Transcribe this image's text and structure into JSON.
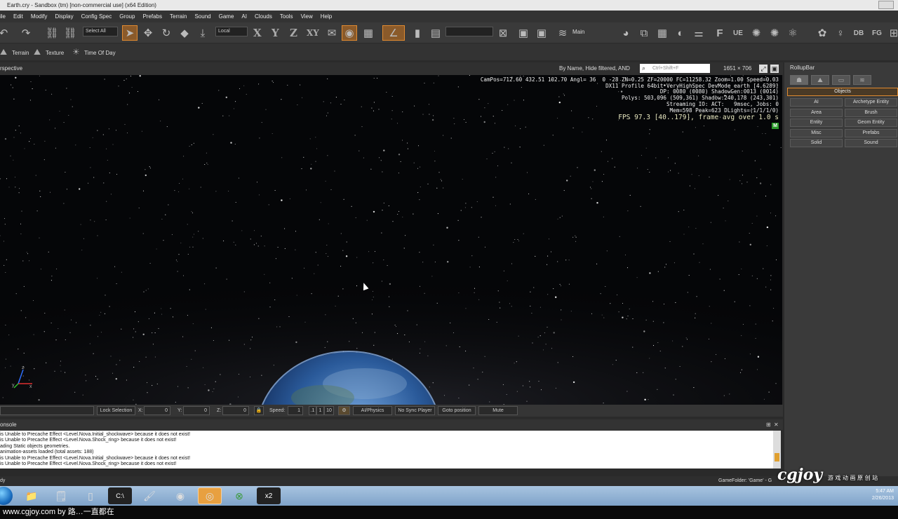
{
  "window": {
    "title": "Earth.cry - Sandbox (tm) [non-commercial use] (x64 Edition)"
  },
  "menu": [
    "ile",
    "Edit",
    "Modify",
    "Display",
    "Config Spec",
    "Group",
    "Prefabs",
    "Terrain",
    "Sound",
    "Game",
    "AI",
    "Clouds",
    "Tools",
    "View",
    "Help"
  ],
  "toolbar": {
    "select_all": "Select All",
    "coord_system": "Local",
    "axis_x": "X",
    "axis_y": "Y",
    "axis_z": "Z",
    "axis_xy": "XY",
    "layer": "Main"
  },
  "toolbar2": {
    "terrain": "Terrain",
    "texture": "Texture",
    "time_of_day": "Time Of Day"
  },
  "viewport": {
    "name": "rspective",
    "filter": "By Name, Hide filtered, AND",
    "search_placeholder": "Ctrl+Shift+F",
    "resolution": "1651 × 706",
    "hud": [
      "CamPos=712.60 432.51 102.70 Angl= 36  0 -28 ZN=0.25 ZF=20000 FC=11258.32 Zoom=1.00 Speed=0.03",
      "DX11 Profile 64bit VeryHighSpec DevMode earth [4.6289]",
      "DP: 0080 (0080) ShadowGen:0013 (0014)",
      "Polys: 503,096 (509,361) Shadow:240,178 (243,301)",
      "Streaming IO: ACT:   9msec, Jobs: 0",
      "Mem=598 Peak=623 DLights=(1/1/1/0)"
    ],
    "fps": "FPS 97.3 [40..179], frame avg over 1.0 s",
    "mode_badge": "M"
  },
  "status": {
    "lock_selection": "Lock Selection",
    "x_label": "X:",
    "x_value": "0",
    "y_label": "Y:",
    "y_value": "0",
    "z_label": "Z:",
    "z_value": "0",
    "speed_label": "Speed:",
    "speed_value": "1",
    "speed_opts": [
      ".1",
      "1",
      "10"
    ],
    "ai_physics": "AI/Physics",
    "no_sync": "No Sync Player",
    "goto": "Goto position",
    "mute": "Mute"
  },
  "console": {
    "title": "onsole",
    "lines": [
      "is Unable to Precache Effect <Level.Nova.Initial_shockwave> because it does not exist!",
      "is Unable to Precache Effect <Level.Nova.Shock_ring> because it does not exist!",
      "ading Static objects geometries.",
      "animation-assets loaded (total assets: 188)",
      "is Unable to Precache Effect <Level.Nova.Initial_shockwave> because it does not exist!",
      "is Unable to Precache Effect <Level.Nova.Shock_ring> because it does not exist!"
    ]
  },
  "rollup": {
    "title": "RollupBar",
    "objects": "Objects",
    "buttons": [
      "AI",
      "Archetype Entity",
      "Area",
      "Brush",
      "Entity",
      "Geom Entity",
      "Misc",
      "Prefabs",
      "Solid",
      "Sound"
    ]
  },
  "statusbar": {
    "left": "dy",
    "game_folder": "GameFolder: 'Game' - G"
  },
  "taskbar": {
    "time": "5:47 AM",
    "date": "2/26/2013"
  },
  "footer": {
    "text": "www.cgjoy.com by 路…一直都在"
  },
  "watermark": {
    "logo": "cgjoy",
    "sub": "游 戏 动 画 原 创 站"
  }
}
